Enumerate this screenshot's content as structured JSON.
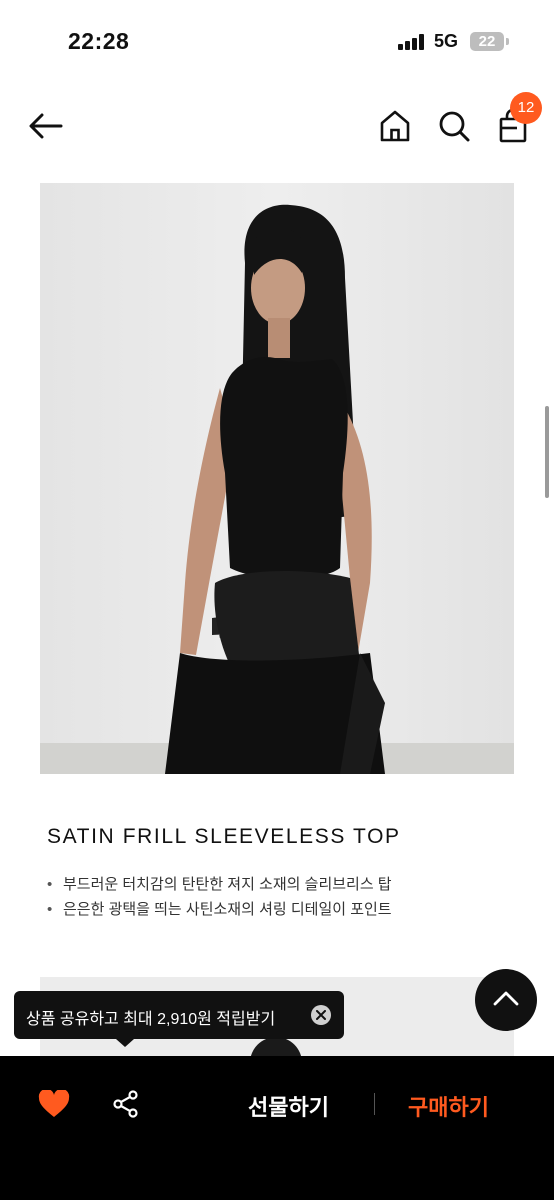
{
  "status_bar": {
    "time": "22:28",
    "network": "5G",
    "battery": "22"
  },
  "header": {
    "cart_count": "12",
    "accent_color": "#ff5a1f",
    "icons": [
      "back-arrow-icon",
      "home-icon",
      "search-icon",
      "shopping-bag-icon"
    ]
  },
  "product": {
    "title": "SATIN FRILL SLEEVELESS TOP",
    "bullet_mark": "•",
    "bullets": [
      "부드러운 터치감의 탄탄한 져지 소재의 슬리브리스 탑",
      "은은한 광택을 띄는 사틴소재의 셔링 디테일이 포인트"
    ]
  },
  "tooltip": {
    "text": "상품 공유하고 최대 2,910원 적립받기"
  },
  "bottom_bar": {
    "gift_label": "선물하기",
    "buy_label": "구매하기",
    "buy_color": "#ff5a1f",
    "heart_color": "#ff5a1f"
  }
}
